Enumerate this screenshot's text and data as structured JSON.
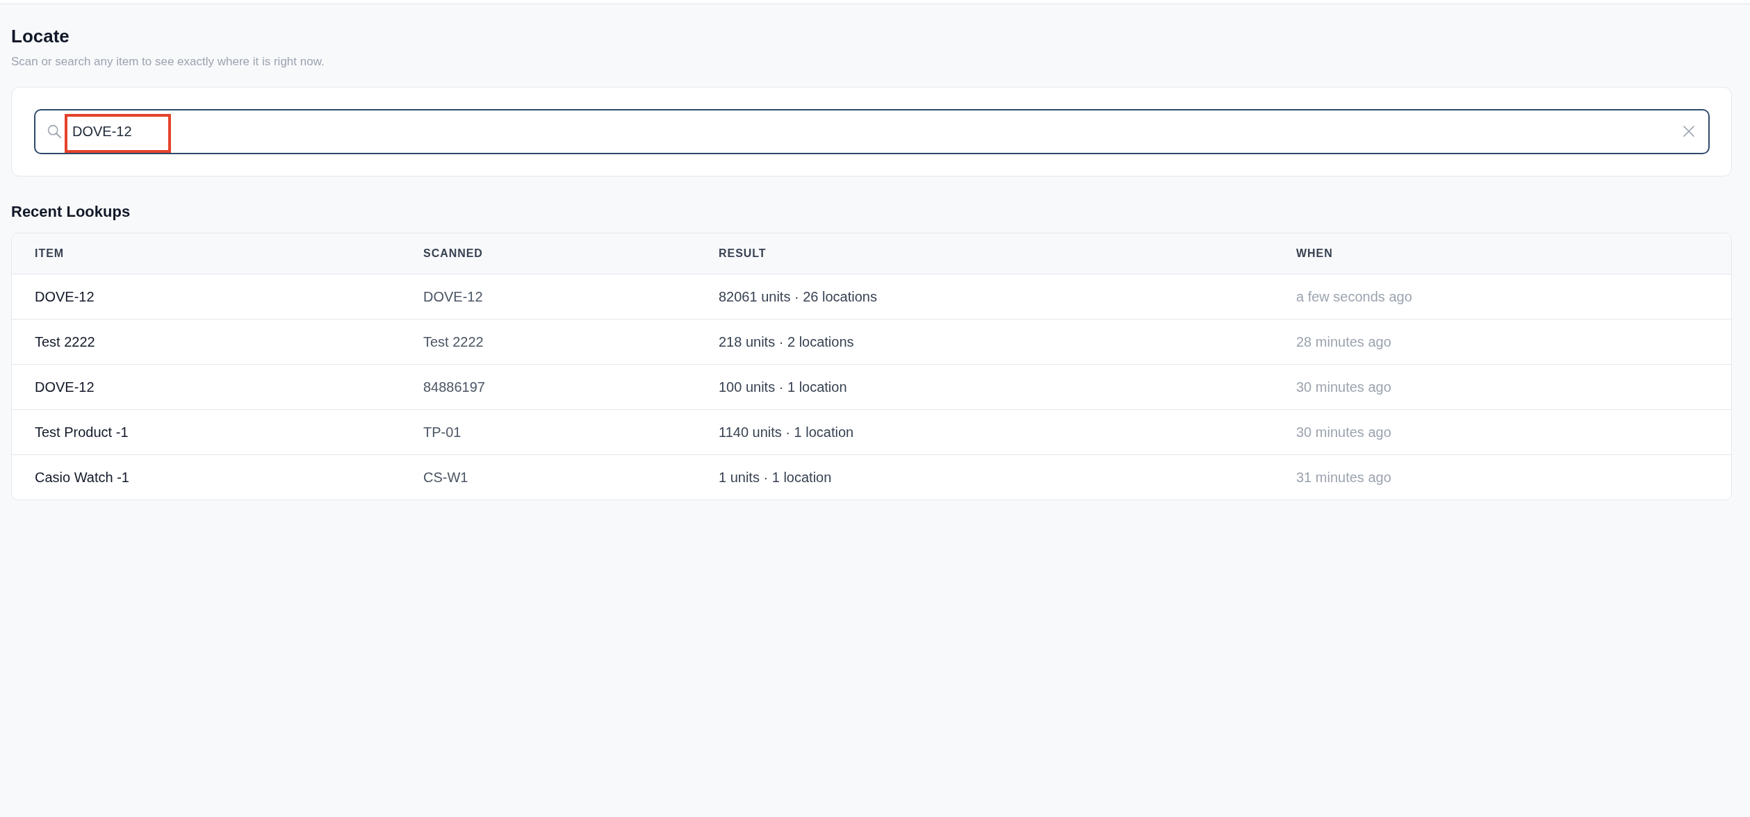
{
  "page": {
    "title": "Locate",
    "subtitle": "Scan or search any item to see exactly where it is right now."
  },
  "search": {
    "value": "DOVE-12",
    "value_highlighted": true
  },
  "recent_lookups": {
    "title": "Recent Lookups",
    "columns": [
      "ITEM",
      "SCANNED",
      "RESULT",
      "WHEN"
    ],
    "rows": [
      {
        "item": "DOVE-12",
        "scanned": "DOVE-12",
        "result": "82061 units · 26 locations",
        "when": "a few seconds ago"
      },
      {
        "item": "Test 2222",
        "scanned": "Test 2222",
        "result": "218 units · 2 locations",
        "when": "28 minutes ago"
      },
      {
        "item": "DOVE-12",
        "scanned": "84886197",
        "result": "100 units · 1 location",
        "when": "30 minutes ago"
      },
      {
        "item": "Test Product -1",
        "scanned": "TP-01",
        "result": "1140 units · 1 location",
        "when": "30 minutes ago"
      },
      {
        "item": "Casio Watch -1",
        "scanned": "CS-W1",
        "result": "1 units · 1 location",
        "when": "31 minutes ago"
      }
    ]
  }
}
